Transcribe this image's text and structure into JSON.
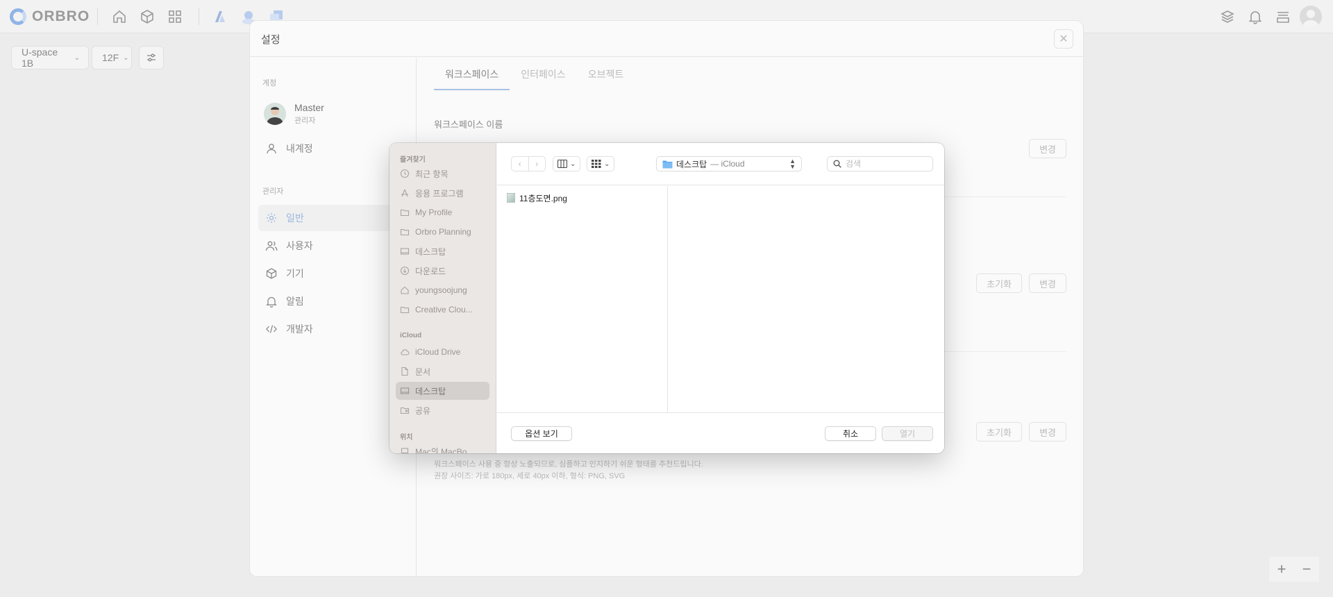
{
  "app": {
    "brand": "ORBRO",
    "building_selector": "U-space 1B",
    "floor_selector": "12F"
  },
  "settings": {
    "title": "설정",
    "sidebar": {
      "account_section": "계정",
      "profile": {
        "name": "Master",
        "role": "관리자"
      },
      "my_account": "내계정",
      "admin_section": "관리자",
      "items": [
        {
          "label": "일반",
          "icon": "gear-icon",
          "active": true
        },
        {
          "label": "사용자",
          "icon": "users-icon",
          "active": false
        },
        {
          "label": "기기",
          "icon": "cube-icon",
          "active": false
        },
        {
          "label": "알림",
          "icon": "bell-icon",
          "active": false
        },
        {
          "label": "개발자",
          "icon": "code-icon",
          "active": false
        }
      ]
    },
    "tabs": [
      {
        "label": "워크스페이스",
        "active": true
      },
      {
        "label": "인터페이스",
        "active": false
      },
      {
        "label": "오브젝트",
        "active": false
      }
    ],
    "workspace_name_title": "워크스페이스 이름",
    "buttons": {
      "change": "변경",
      "reset": "초기화"
    },
    "logo_help": [
      "워크스페이스 사용 중 항상 노출되므로, 심플하고 인지하기 쉬운 형태를 추천드립니다.",
      "권장 사이즈: 가로 180px, 세로 40px 이하, 형식: PNG, SVG"
    ]
  },
  "file_dialog": {
    "favorites_section": "즐겨찾기",
    "favorites": [
      {
        "label": "최근 항목",
        "icon": "clock-icon"
      },
      {
        "label": "응용 프로그램",
        "icon": "apps-icon"
      },
      {
        "label": "My Profile",
        "icon": "folder-icon"
      },
      {
        "label": "Orbro Planning",
        "icon": "folder-icon"
      },
      {
        "label": "데스크탑",
        "icon": "desktop-icon"
      },
      {
        "label": "다운로드",
        "icon": "download-icon"
      },
      {
        "label": "youngsoojung",
        "icon": "home-icon"
      },
      {
        "label": "Creative Clou...",
        "icon": "folder-icon"
      }
    ],
    "icloud_section": "iCloud",
    "icloud": [
      {
        "label": "iCloud Drive",
        "icon": "cloud-icon"
      },
      {
        "label": "문서",
        "icon": "document-icon"
      },
      {
        "label": "데스크탑",
        "icon": "desktop-icon",
        "active": true
      },
      {
        "label": "공유",
        "icon": "shared-folder-icon"
      }
    ],
    "locations_section": "위치",
    "locations": [
      {
        "label": "Mac의 MacBo...",
        "icon": "laptop-icon"
      }
    ],
    "path": {
      "folder": "데스크탑",
      "location": "— iCloud"
    },
    "search_placeholder": "검색",
    "files": [
      {
        "name": "11층도면.png"
      }
    ],
    "options_button": "옵션 보기",
    "cancel_button": "취소",
    "open_button": "열기"
  }
}
